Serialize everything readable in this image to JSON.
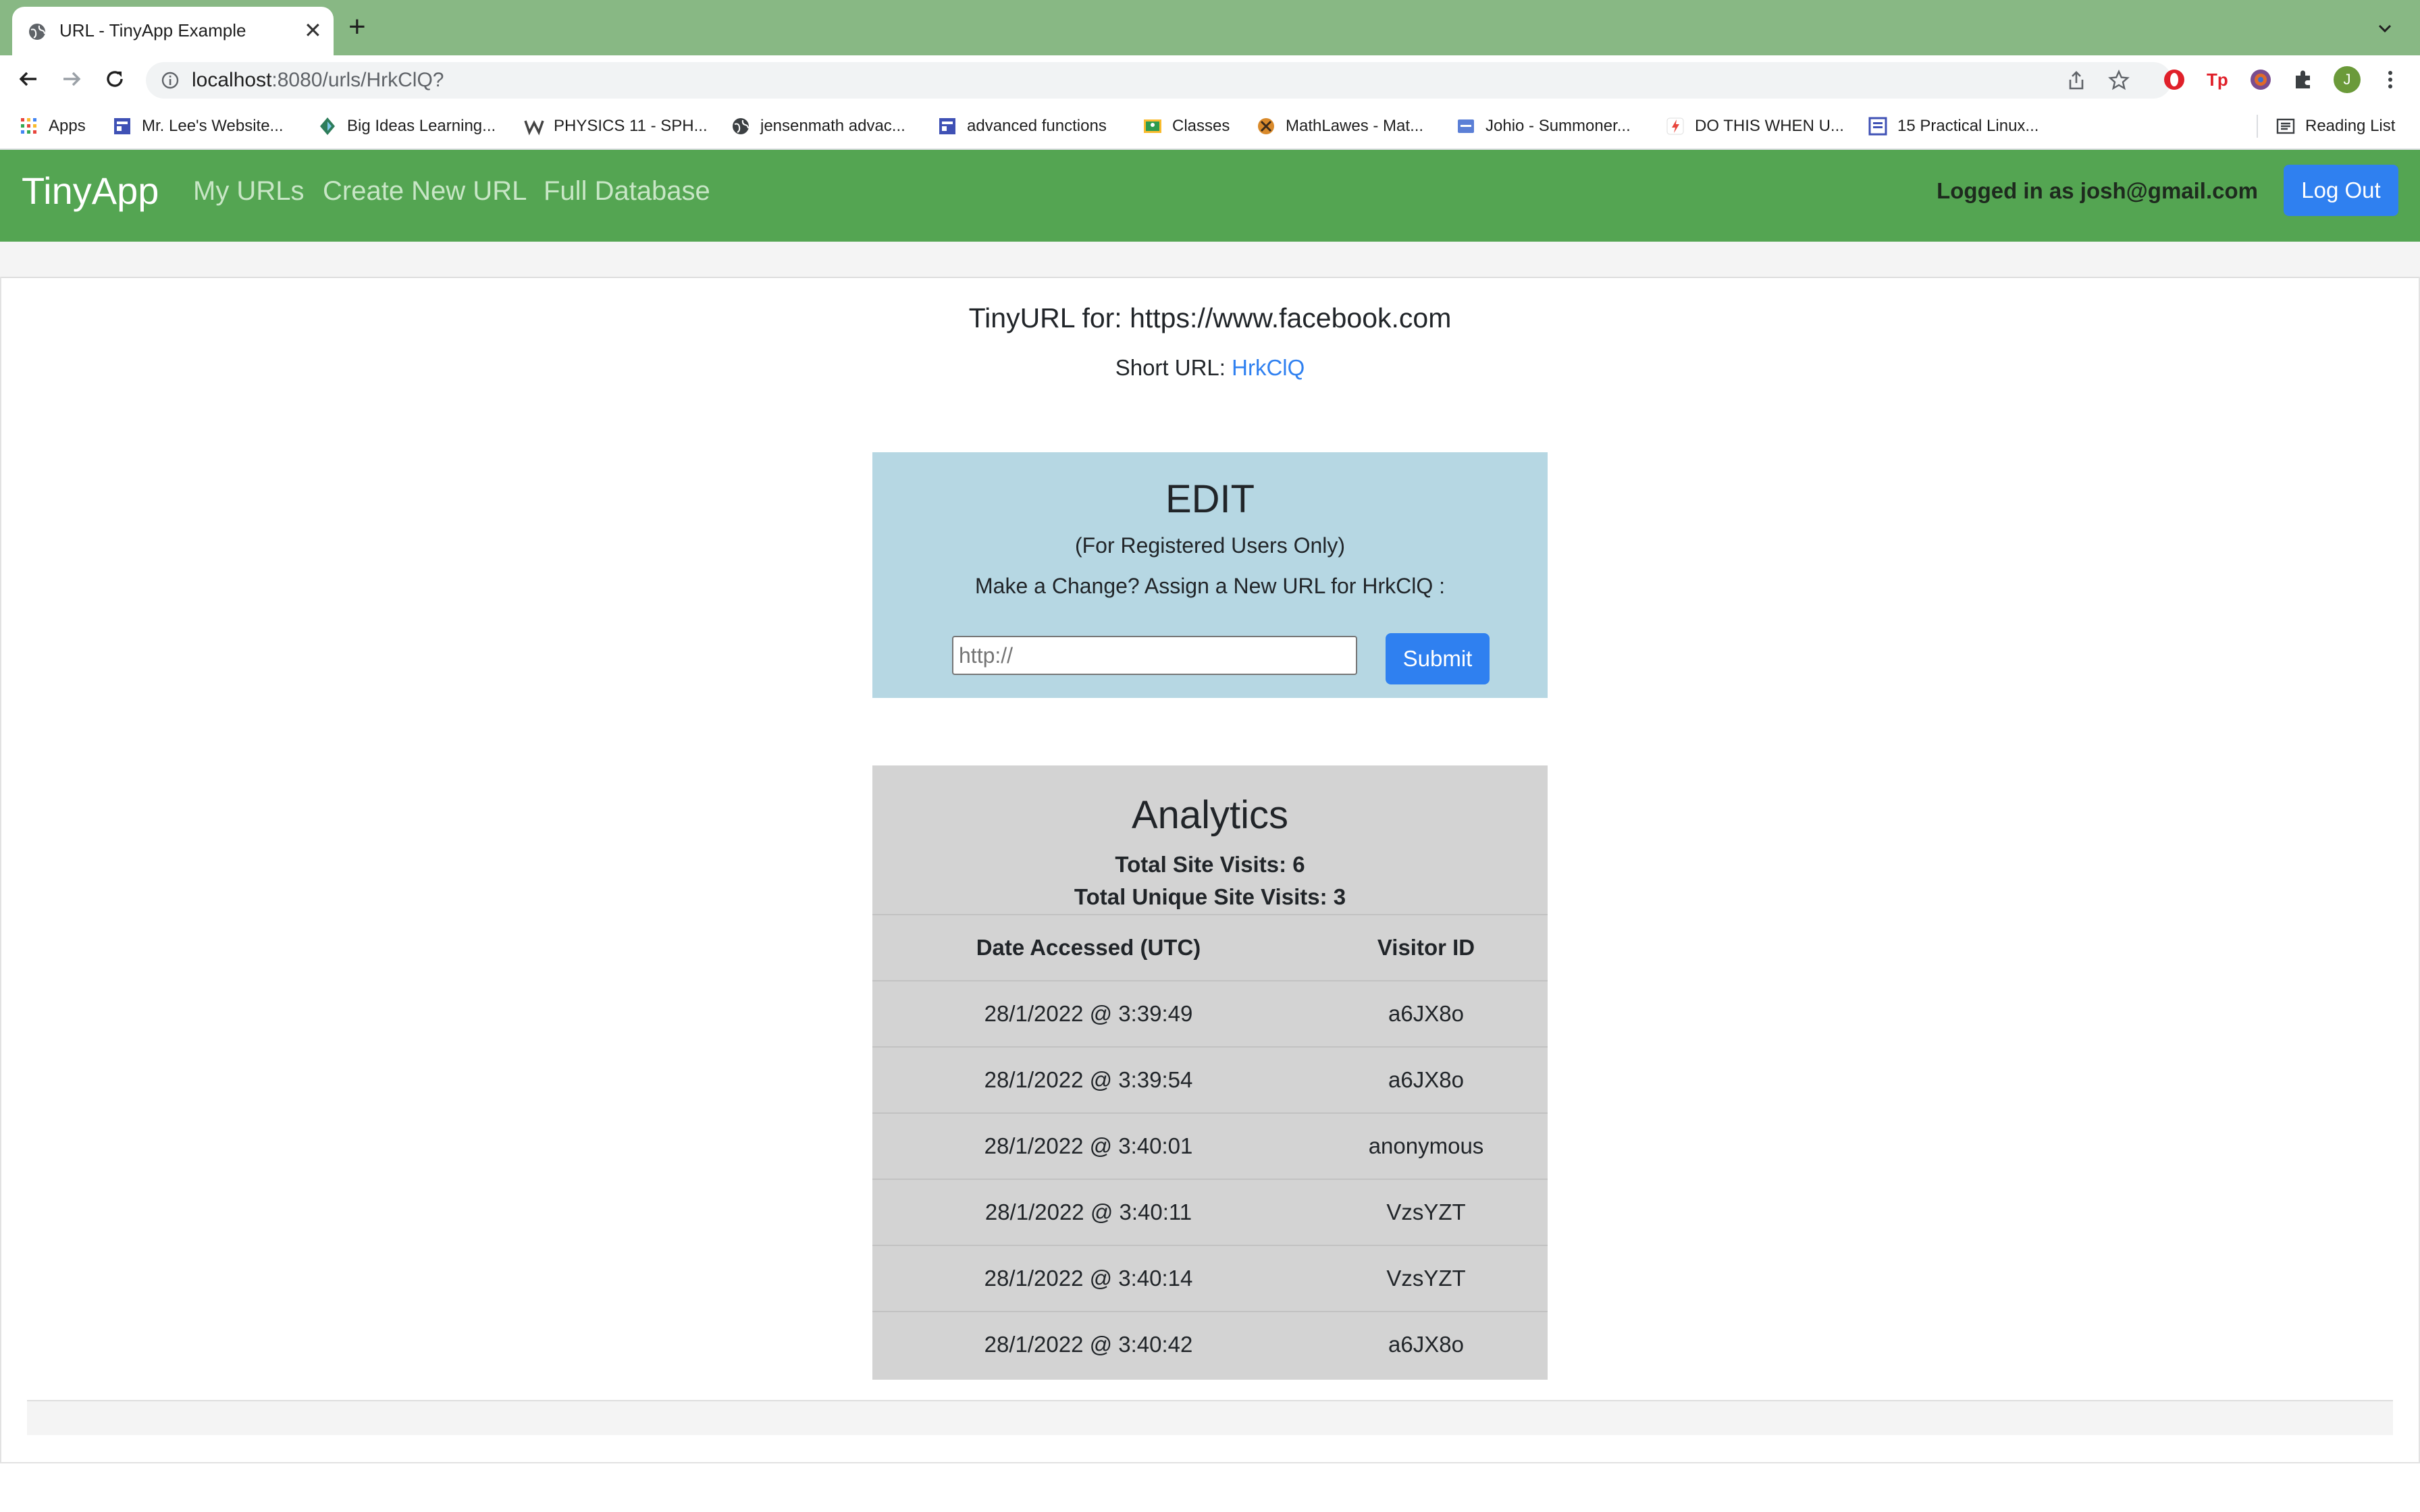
{
  "browser": {
    "tab_title": "URL - TinyApp Example",
    "url_host": "localhost",
    "url_rest": ":8080/urls/HrkClQ?",
    "bookmarks": [
      {
        "label": "Apps",
        "icon": "apps-grid-icon"
      },
      {
        "label": "Mr. Lee's Website...",
        "icon": "site-icon"
      },
      {
        "label": "Big Ideas Learning...",
        "icon": "big-ideas-icon"
      },
      {
        "label": "PHYSICS 11 - SPH...",
        "icon": "weebly-icon"
      },
      {
        "label": "jensenmath advac...",
        "icon": "globe-icon"
      },
      {
        "label": "advanced functions",
        "icon": "site-icon"
      },
      {
        "label": "Classes",
        "icon": "classroom-icon"
      },
      {
        "label": "MathLawes - Mat...",
        "icon": "mathlawes-icon"
      },
      {
        "label": "Johio - Summoner...",
        "icon": "johio-icon"
      },
      {
        "label": "DO THIS WHEN U...",
        "icon": "bolt-icon"
      },
      {
        "label": "15 Practical Linux...",
        "icon": "site-icon"
      }
    ],
    "reading_list": "Reading List",
    "profile_initial": "J"
  },
  "nav": {
    "brand": "TinyApp",
    "links": [
      "My URLs",
      "Create New URL",
      "Full Database"
    ],
    "logged_in": "Logged in as josh@gmail.com",
    "logout": "Log Out"
  },
  "page": {
    "heading": "TinyURL for: https://www.facebook.com",
    "short_url_label": "Short URL:",
    "short_url": "HrkClQ"
  },
  "edit": {
    "title": "EDIT",
    "subtitle": "(For Registered Users Only)",
    "prompt": "Make a Change? Assign a New URL for HrkClQ :",
    "placeholder": "http://",
    "submit": "Submit"
  },
  "analytics": {
    "title": "Analytics",
    "total_visits": "Total Site Visits: 6",
    "unique_visits": "Total Unique Site Visits: 3",
    "columns": [
      "Date Accessed (UTC)",
      "Visitor ID"
    ],
    "rows": [
      [
        "28/1/2022 @ 3:39:49",
        "a6JX8o"
      ],
      [
        "28/1/2022 @ 3:39:54",
        "a6JX8o"
      ],
      [
        "28/1/2022 @ 3:40:01",
        "anonymous"
      ],
      [
        "28/1/2022 @ 3:40:11",
        "VzsYZT"
      ],
      [
        "28/1/2022 @ 3:40:14",
        "VzsYZT"
      ],
      [
        "28/1/2022 @ 3:40:42",
        "a6JX8o"
      ]
    ]
  },
  "colors": {
    "navbar": "#54a552",
    "tabstrip": "#88b884",
    "primary_button": "#2f80f0",
    "edit_box": "#b6d7e3",
    "analytics_box": "#d3d3d3"
  }
}
